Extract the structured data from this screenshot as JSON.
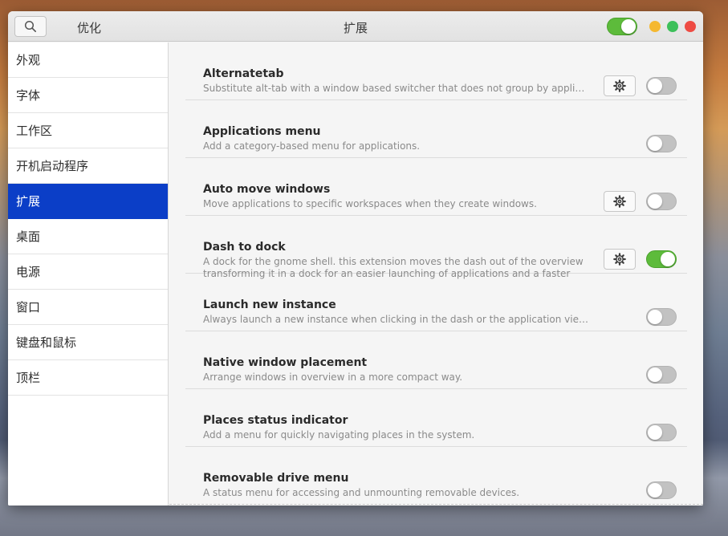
{
  "titlebar": {
    "app_title": "优化",
    "page_title": "扩展",
    "extensions_enabled": true
  },
  "sidebar": {
    "items": [
      {
        "label": "外观",
        "active": false
      },
      {
        "label": "字体",
        "active": false
      },
      {
        "label": "工作区",
        "active": false
      },
      {
        "label": "开机启动程序",
        "active": false
      },
      {
        "label": "扩展",
        "active": true
      },
      {
        "label": "桌面",
        "active": false
      },
      {
        "label": "电源",
        "active": false
      },
      {
        "label": "窗口",
        "active": false
      },
      {
        "label": "键盘和鼠标",
        "active": false
      },
      {
        "label": "顶栏",
        "active": false
      }
    ]
  },
  "extensions": [
    {
      "name": "Alternatetab",
      "description": "Substitute alt-tab with a window based switcher that does not group by application.",
      "has_settings": true,
      "enabled": false
    },
    {
      "name": "Applications menu",
      "description": "Add a category-based menu for applications.",
      "has_settings": false,
      "enabled": false
    },
    {
      "name": "Auto move windows",
      "description": "Move applications to specific workspaces when they create windows.",
      "has_settings": true,
      "enabled": false
    },
    {
      "name": "Dash to dock",
      "description": "A dock for the gnome shell. this extension moves the dash out of the overview transforming it in a dock for an easier launching of applications and a faster switchin…",
      "has_settings": true,
      "enabled": true
    },
    {
      "name": "Launch new instance",
      "description": "Always launch a new instance when clicking in the dash or the application view.",
      "has_settings": false,
      "enabled": false
    },
    {
      "name": "Native window placement",
      "description": "Arrange windows in overview in a more compact way.",
      "has_settings": false,
      "enabled": false
    },
    {
      "name": "Places status indicator",
      "description": "Add a menu for quickly navigating places in the system.",
      "has_settings": false,
      "enabled": false
    },
    {
      "name": "Removable drive menu",
      "description": "A status menu for accessing and unmounting removable devices.",
      "has_settings": false,
      "enabled": false
    }
  ],
  "colors": {
    "accent": "#0b3ec7",
    "toggle_on": "#5dbb3b",
    "toggle_off": "#c2c2c2"
  }
}
